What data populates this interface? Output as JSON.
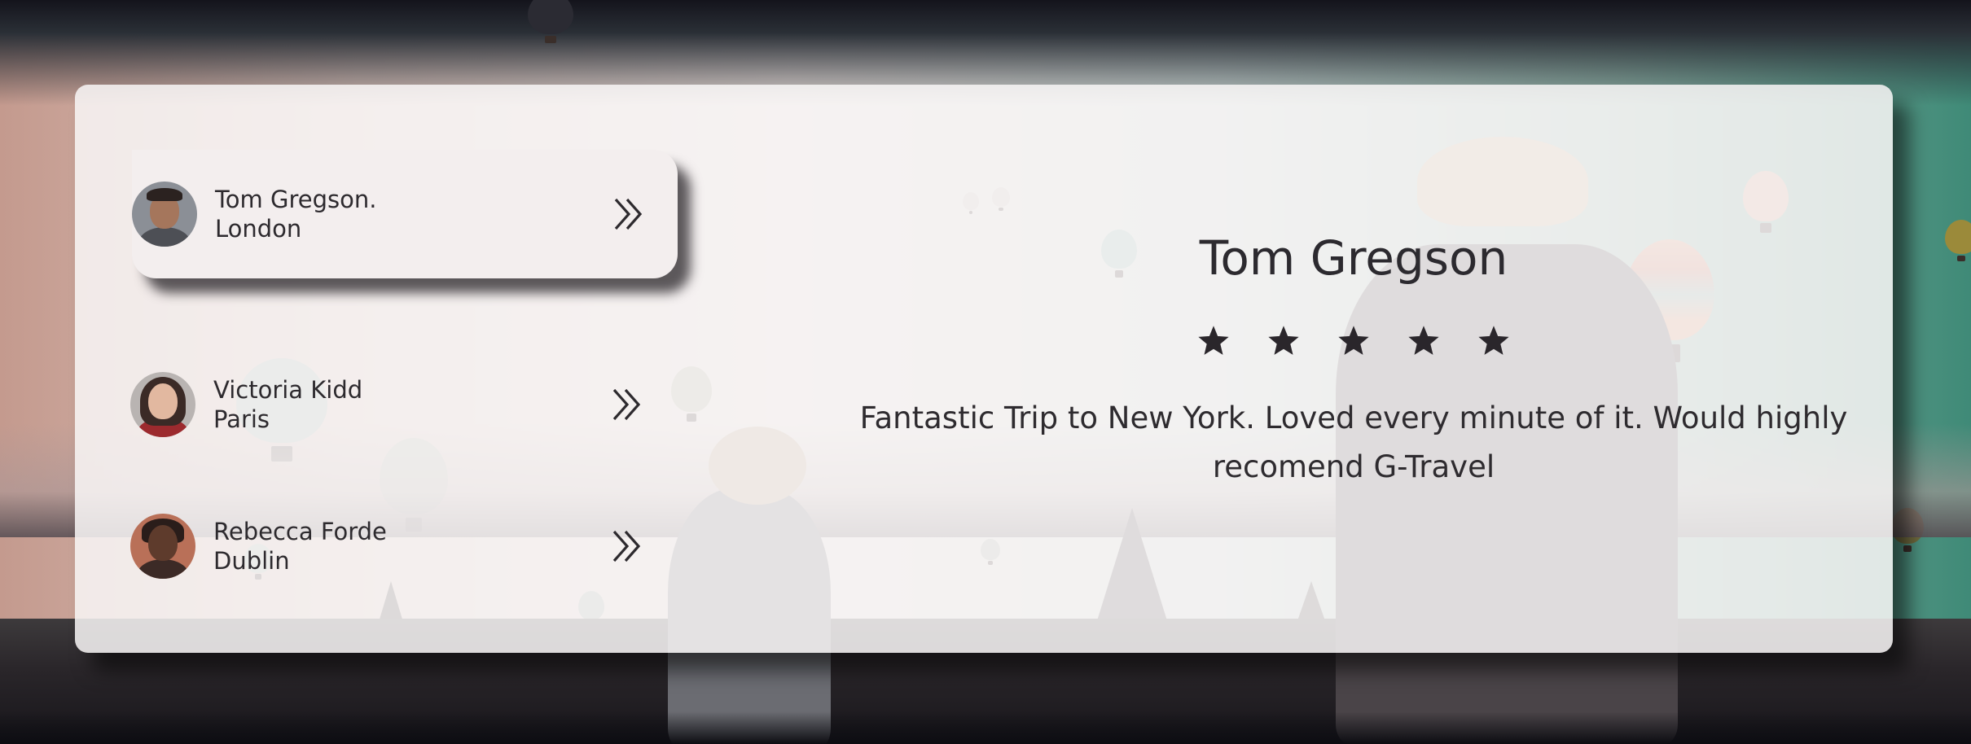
{
  "testimonials": [
    {
      "name": "Tom Gregson.",
      "city": "London",
      "active": true
    },
    {
      "name": "Victoria Kidd",
      "city": "Paris",
      "active": false
    },
    {
      "name": "Rebecca Forde",
      "city": "Dublin",
      "active": false
    }
  ],
  "selected": {
    "name": "Tom Gregson",
    "rating": 5,
    "rating_max": 5,
    "quote": "Fantastic Trip to New York. Loved every minute of it. Would highly recomend G-Travel"
  },
  "icons": {
    "next": "chevron-double-right-icon",
    "star": "star-icon"
  },
  "colors": {
    "text": "#2d2a2e",
    "card": "#f8f6f6",
    "active_item": "#f3eeee"
  }
}
